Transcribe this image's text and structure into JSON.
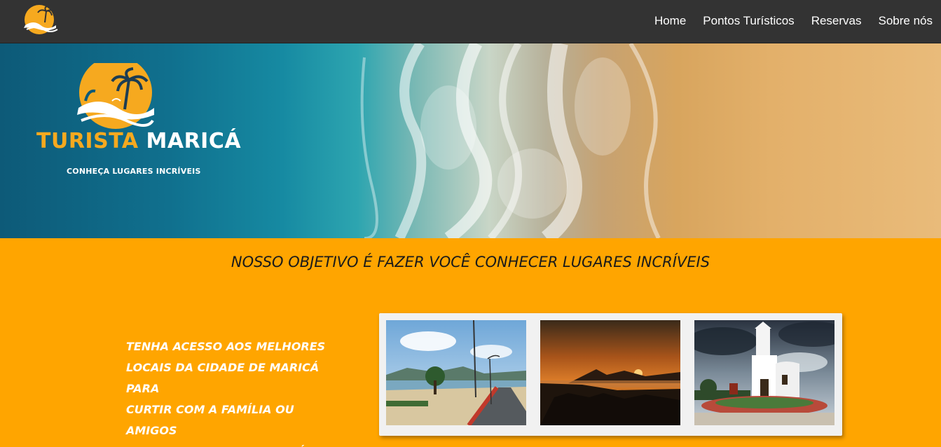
{
  "nav": {
    "logo_icon": "beach-sun-palm-logo",
    "links": [
      "Home",
      "Pontos Turísticos",
      "Reservas",
      "Sobre nós"
    ]
  },
  "hero": {
    "brand_part1": "TURISTA",
    "brand_part2": "MARICÁ",
    "tagline": "CONHEÇA LUGARES INCRÍVEIS",
    "logo_icon": "beach-sun-palm-logo",
    "background": "aerial-beach-waves"
  },
  "main": {
    "headline": "NOSSO OBJETIVO É FAZER VOCÊ CONHECER LUGARES INCRÍVEIS",
    "promo_lines": [
      "TENHA ACESSO AOS MELHORES",
      "LOCAIS DA CIDADE DE MARICÁ PARA",
      "CURTIR COM A FAMÍLIA OU AMIGOS",
      "PELO MELHOR PREÇO POSSÍVEL."
    ],
    "gallery": [
      {
        "name": "beach-boardwalk-photo"
      },
      {
        "name": "sunset-photo"
      },
      {
        "name": "church-photo"
      }
    ]
  },
  "colors": {
    "navbar": "#333333",
    "background": "#ffa500",
    "accent": "#f6a91f"
  }
}
